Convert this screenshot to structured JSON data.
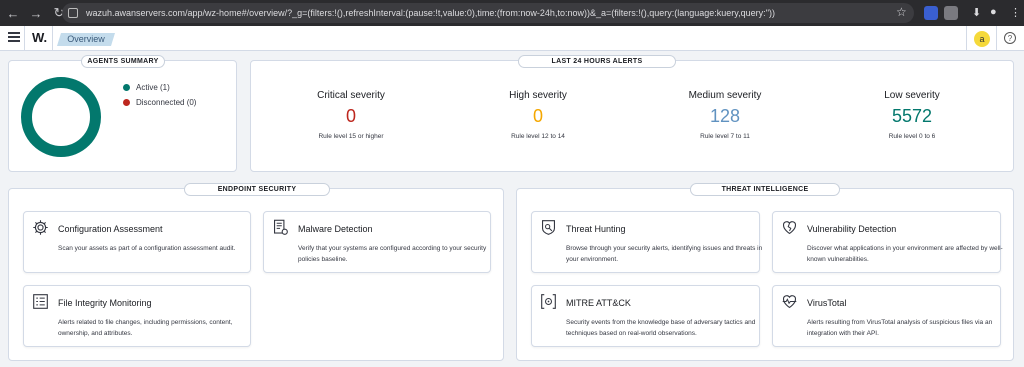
{
  "browser": {
    "url": "wazuh.awanservers.com/app/wz-home#/overview/?_g=(filters:!(),refreshInterval:(pause:!t,value:0),time:(from:now-24h,to:now))&_a=(filters:!(),query:(language:kuery,query:''))",
    "nav_icons": [
      "back-icon",
      "forward-icon",
      "reload-icon"
    ],
    "star_icon": "bookmark-star-icon"
  },
  "app": {
    "logo": "W.",
    "breadcrumb": "Overview",
    "avatar_letter": "a",
    "help_glyph": "?"
  },
  "agents_summary": {
    "title": "AGENTS SUMMARY",
    "active_label": "Active (1)",
    "disconnected_label": "Disconnected (0)",
    "active_color": "#03786d",
    "disconnected_color": "#bd271e",
    "active_fraction": 1.0
  },
  "alerts": {
    "title": "LAST 24 HOURS ALERTS",
    "items": [
      {
        "label": "Critical severity",
        "value": "0",
        "sub": "Rule level 15 or higher",
        "color": "#bd271e"
      },
      {
        "label": "High severity",
        "value": "0",
        "sub": "Rule level 12 to 14",
        "color": "#f5a700"
      },
      {
        "label": "Medium severity",
        "value": "128",
        "sub": "Rule level 7 to 11",
        "color": "#6092c0"
      },
      {
        "label": "Low severity",
        "value": "5572",
        "sub": "Rule level 0 to 6",
        "color": "#03786d"
      }
    ]
  },
  "endpoint": {
    "title": "ENDPOINT SECURITY",
    "cards": [
      {
        "title": "Configuration Assessment",
        "desc": "Scan your assets as part of a configuration assessment audit.",
        "icon": "gear-icon"
      },
      {
        "title": "Malware Detection",
        "desc": "Verify that your systems are configured according to your security policies baseline.",
        "icon": "document-gear-icon"
      },
      {
        "title": "File Integrity Monitoring",
        "desc": "Alerts related to file changes, including permissions, content, ownership, and attributes.",
        "icon": "list-document-icon"
      }
    ]
  },
  "threat": {
    "title": "THREAT INTELLIGENCE",
    "cards": [
      {
        "title": "Threat Hunting",
        "desc": "Browse through your security alerts, identifying issues and threats in your environment.",
        "icon": "shield-search-icon"
      },
      {
        "title": "Vulnerability Detection",
        "desc": "Discover what applications in your environment are affected by well-known vulnerabilities.",
        "icon": "heart-broken-icon"
      },
      {
        "title": "MITRE ATT&CK",
        "desc": "Security events from the knowledge base of adversary tactics and techniques based on real-world observations.",
        "icon": "bracket-target-icon"
      },
      {
        "title": "VirusTotal",
        "desc": "Alerts resulting from VirusTotal analysis of suspicious files via an integration with their API.",
        "icon": "heart-pulse-icon"
      }
    ]
  }
}
